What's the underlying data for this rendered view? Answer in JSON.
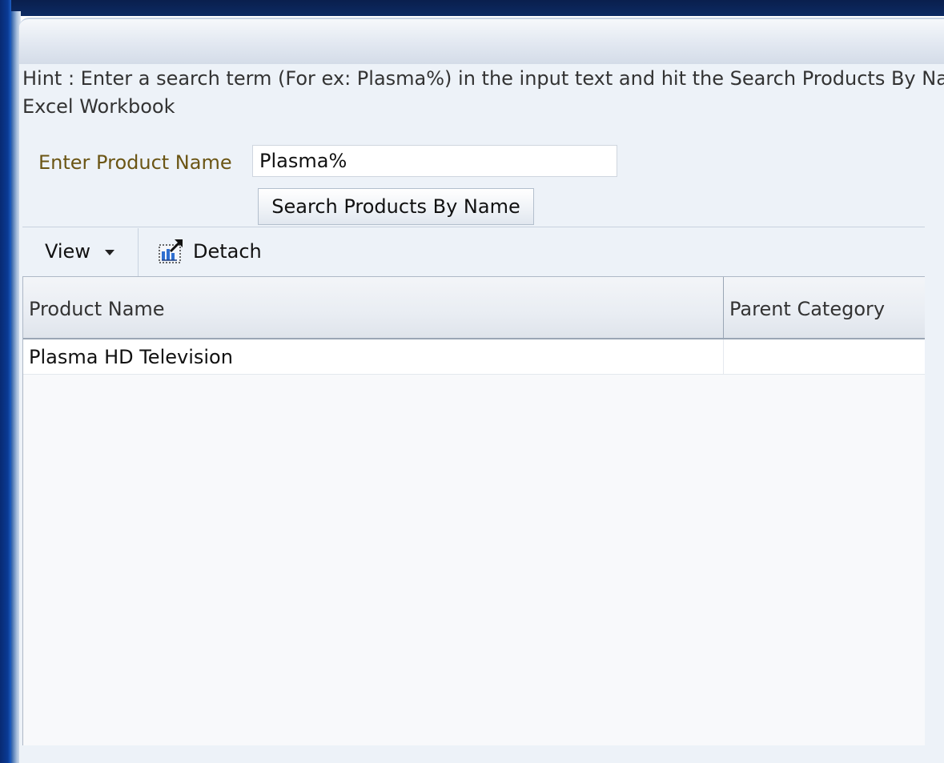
{
  "hint": {
    "line1": "Hint : Enter a search term (For ex: Plasma%) in the input text and hit the Search Products By Name button to search for products in the",
    "line2": "Excel Workbook"
  },
  "search": {
    "label": "Enter Product Name",
    "value": "Plasma%",
    "button_label": "Search Products By Name"
  },
  "toolbar": {
    "view_label": "View",
    "detach_label": "Detach"
  },
  "table": {
    "columns": [
      "Product Name",
      "Parent Category"
    ],
    "rows": [
      [
        "Plasma HD Television",
        ""
      ]
    ]
  }
}
